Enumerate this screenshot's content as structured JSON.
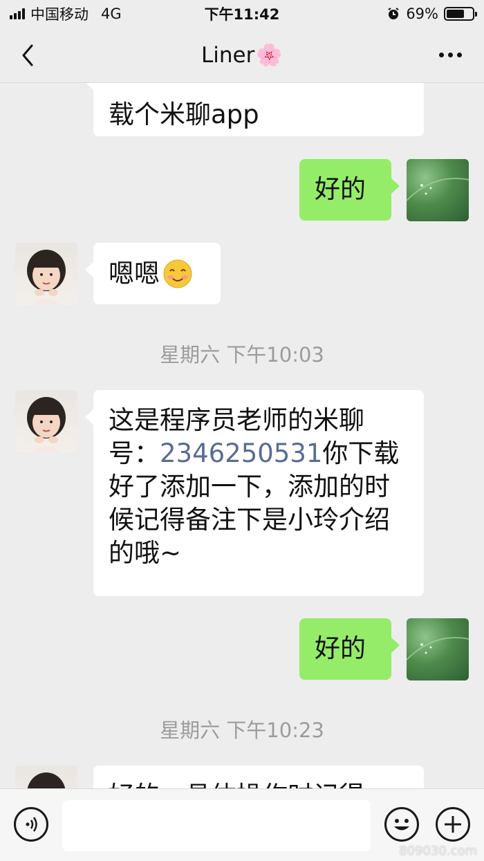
{
  "status_bar": {
    "carrier": "中国移动",
    "network": "4G",
    "time": "下午11:42",
    "battery_percent": "69%",
    "battery_level": 0.69
  },
  "nav": {
    "title": "Liner",
    "title_emoji": "🌸"
  },
  "messages": [
    {
      "side": "left",
      "text": "载个米聊app"
    },
    {
      "side": "right",
      "text": "好的"
    },
    {
      "side": "left",
      "text": "嗯嗯"
    },
    {
      "side": "left",
      "text_before_link": "这是程序员老师的米聊号：",
      "link": "2346250531",
      "text_after_link": "你下载好了添加一下，添加的时候记得备注下是小玲介绍的哦~"
    },
    {
      "side": "right",
      "text": "好的"
    },
    {
      "side": "left",
      "text": "好的，具体操作时记得"
    }
  ],
  "timestamps": [
    "星期六 下午10:03",
    "星期六 下午10:23"
  ],
  "input_bar": {
    "placeholder": ""
  },
  "watermark": "809030.com",
  "colors": {
    "background": "#ededed",
    "bubble_self": "#95ec69",
    "bubble_other": "#ffffff",
    "link": "#576b95"
  }
}
